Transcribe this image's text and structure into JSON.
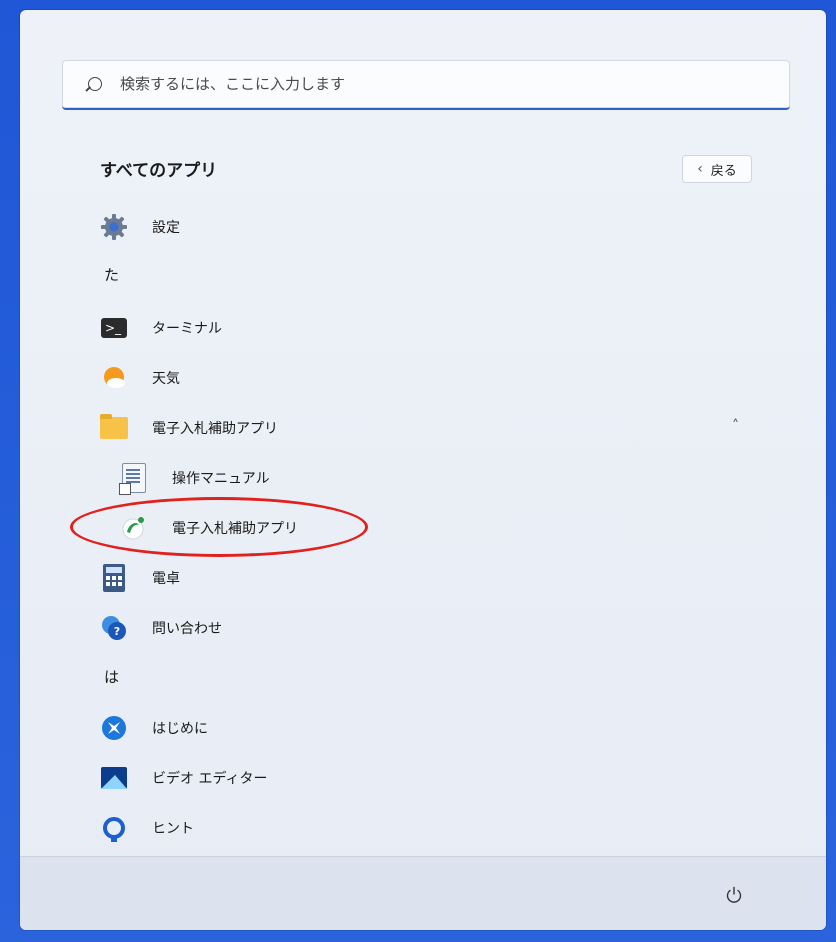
{
  "search": {
    "placeholder": "検索するには、ここに入力します"
  },
  "header": {
    "title": "すべてのアプリ",
    "back_label": "戻る"
  },
  "apps": [
    {
      "label": "設定",
      "icon": "gear-icon"
    },
    {
      "letter": "た"
    },
    {
      "label": "ターミナル",
      "icon": "terminal-icon"
    },
    {
      "label": "天気",
      "icon": "weather-icon"
    },
    {
      "label": "電子入札補助アプリ",
      "icon": "folder-icon",
      "expanded": true
    },
    {
      "label": "操作マニュアル",
      "icon": "document-shortcut-icon"
    },
    {
      "label": "電子入札補助アプリ",
      "icon": "ebid-app-icon",
      "highlighted": true
    },
    {
      "label": "電卓",
      "icon": "calculator-icon"
    },
    {
      "label": "問い合わせ",
      "icon": "help-icon"
    },
    {
      "letter": "は"
    },
    {
      "label": "はじめに",
      "icon": "get-started-icon"
    },
    {
      "label": "ビデオ エディター",
      "icon": "video-editor-icon"
    },
    {
      "label": "ヒント",
      "icon": "tips-icon"
    }
  ],
  "colors": {
    "accent": "#2b62c9",
    "highlight": "#e0211d",
    "taskbar": "#1f57d6"
  }
}
